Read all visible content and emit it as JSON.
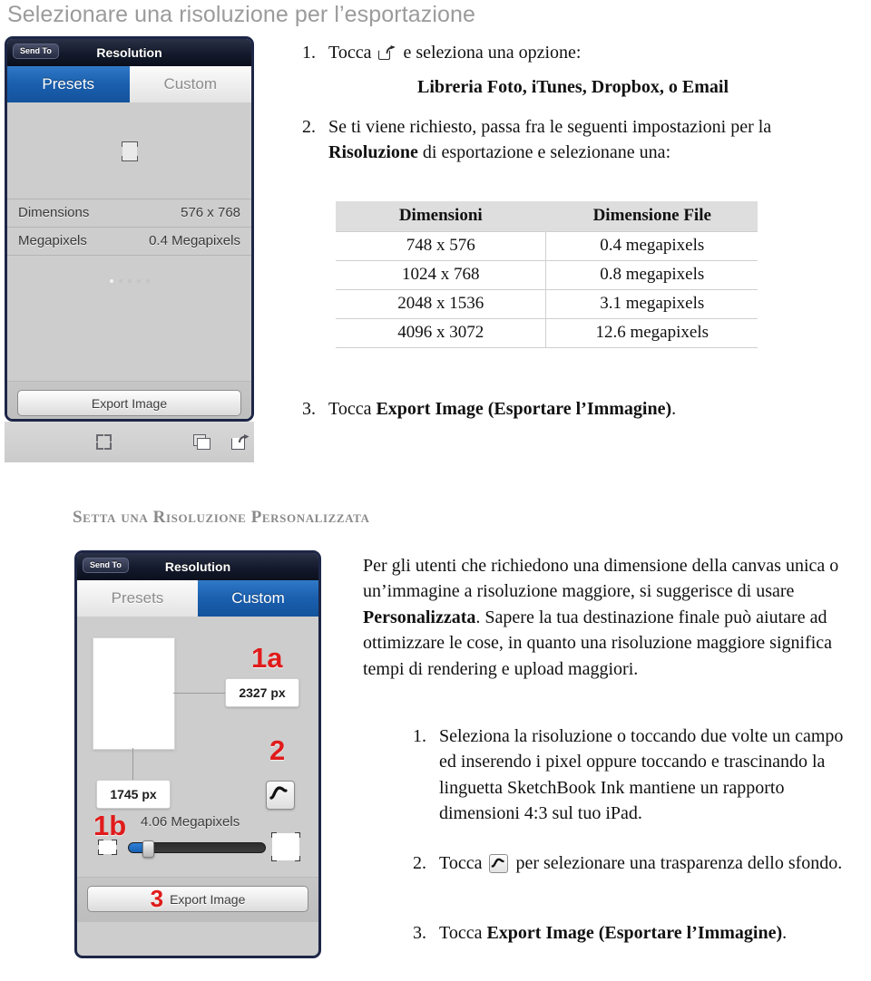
{
  "page": {
    "title": "Selezionare una risoluzione per l’esportazione",
    "section_heading": "Setta una Risoluzione Personalizzata"
  },
  "steps_top": [
    {
      "num": "1.",
      "before_icon": "Tocca",
      "icon": "share-icon",
      "after_icon": "e seleziona una opzione:",
      "emphasis": "Libreria Foto, iTunes, Dropbox, o Email"
    },
    {
      "num": "2.",
      "line1_a": "Se ti viene richiesto, passa fra le seguenti impostazioni per la",
      "line2_bold": "Risoluzione",
      "line2_rest": "di esportazione e selezionane una:"
    },
    {
      "num": "3.",
      "prefix": "Tocca",
      "bold": "Export Image (Esportare l’Immagine)",
      "suffix": "."
    }
  ],
  "table": {
    "headers": [
      "Dimensioni",
      "Dimensione File"
    ],
    "rows": [
      [
        "748 x 576",
        "0.4 megapixels"
      ],
      [
        "1024 x 768",
        "0.8 megapixels"
      ],
      [
        "2048 x 1536",
        "3.1 megapixels"
      ],
      [
        "4096 x 3072",
        "12.6 megapixels"
      ]
    ]
  },
  "paragraph": {
    "part1": "Per gli utenti che richiedono una dimensione della canvas unica o un’immagine a risoluzione maggiore, si suggerisce di usare ",
    "bold": "Personalizzata",
    "part2": ". Sapere la tua destinazione finale può aiutare ad ottimizzare le cose, in quanto una risoluzione maggiore significa tempi di rendering e upload maggiori."
  },
  "steps_bottom": [
    {
      "num": "1.",
      "text": "Seleziona la risoluzione o toccando due volte un campo ed inserendo i pixel oppure toccando e trascinando la linguetta SketchBook Ink mantiene un rapporto dimensioni 4:3 sul tuo iPad."
    },
    {
      "num": "2.",
      "prefix": "Tocca",
      "icon": "curve-icon",
      "suffix": "per selezionare una trasparenza dello sfondo."
    },
    {
      "num": "3.",
      "prefix": "Tocca",
      "bold": "Export Image (Esportare l’Immagine)",
      "suffix": "."
    }
  ],
  "screenshot_presets": {
    "send_to": "Send To",
    "title": "Resolution",
    "tab_presets": "Presets",
    "tab_custom": "Custom",
    "dimensions_label": "Dimensions",
    "dimensions_value": "576 x 768",
    "megapixels_label": "Megapixels",
    "megapixels_value": "0.4 Megapixels",
    "export_button": "Export Image",
    "page_dots": 5,
    "active_dot": 1,
    "toolbar_icons": [
      "expand-icon",
      "layers-icon",
      "share-icon"
    ]
  },
  "screenshot_custom": {
    "send_to": "Send To",
    "title": "Resolution",
    "tab_presets": "Presets",
    "tab_custom": "Custom",
    "width_value": "2327 px",
    "height_value": "1745 px",
    "megapixels_value": "4.06 Megapixels",
    "export_button": "Export Image",
    "callouts": {
      "c1a": "1a",
      "c1b": "1b",
      "c2": "2",
      "c3": "3"
    }
  },
  "colors": {
    "title_gray": "#9b9b9b",
    "heading_gray": "#8a8a8a",
    "ios_blue": "#1a5fae",
    "callout_red": "#e01b1b",
    "table_header_bg": "#dedede",
    "popover_border": "#1d2647"
  }
}
